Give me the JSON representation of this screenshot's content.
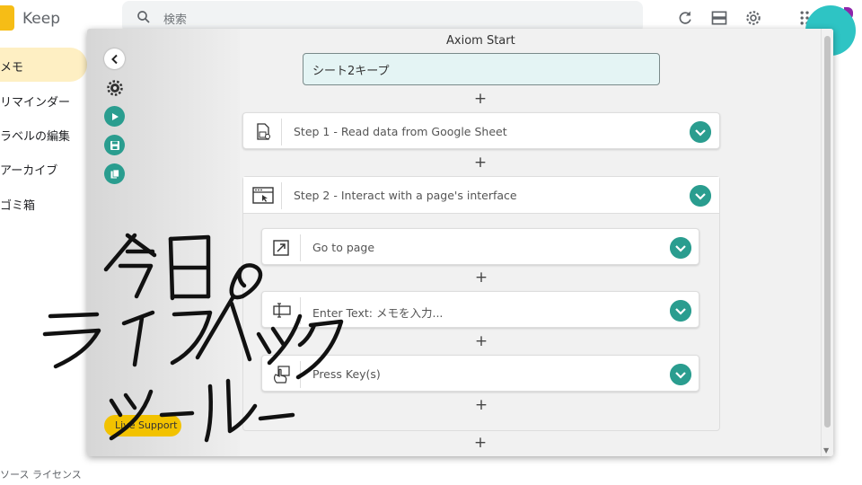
{
  "keep": {
    "title": "Keep",
    "search_placeholder": "検索",
    "sidebar": [
      {
        "label": "メモ",
        "active": true
      },
      {
        "label": "リマインダー"
      },
      {
        "label": "ラベルの編集"
      },
      {
        "label": "アーカイブ"
      },
      {
        "label": "ゴミ箱"
      }
    ],
    "footer": "ソース ライセンス"
  },
  "axiom": {
    "title": "Axiom Start",
    "name_value": "シート2キープ",
    "plus": "+",
    "steps": [
      {
        "label": "Step 1 - Read data from Google Sheet",
        "icon": "sheet-icon"
      },
      {
        "label": "Step 2 - Interact with a page's interface",
        "icon": "browser-window-icon"
      }
    ],
    "substeps": [
      {
        "label": "Go to page",
        "icon": "open-link-icon"
      },
      {
        "label": "Enter Text: メモを入力...",
        "icon": "text-input-icon"
      },
      {
        "label": "Press Key(s)",
        "icon": "press-key-hand-icon"
      }
    ],
    "live_support": "Live Support"
  },
  "colors": {
    "accent": "#2a9d8f",
    "keep_yellow": "#f6bd16",
    "live_support": "#f2c200",
    "sidebar_active": "#feefc3"
  }
}
